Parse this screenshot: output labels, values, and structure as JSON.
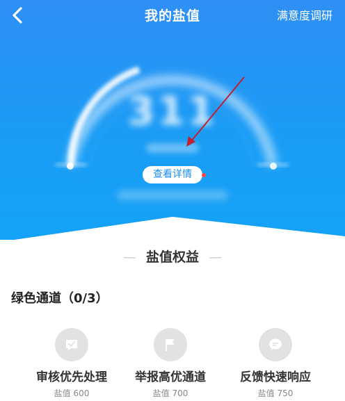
{
  "header": {
    "title": "我的盐值",
    "survey_label": "满意度调研"
  },
  "score": {
    "value": "311",
    "detail_button": "查看详情"
  },
  "rights": {
    "title": "盐值权益",
    "channel_title": "绿色通道（0/3）",
    "items": [
      {
        "label": "审核优先处理",
        "requirement": "盐值 600",
        "icon": "check-message-icon"
      },
      {
        "label": "举报高优通道",
        "requirement": "盐值 700",
        "icon": "flag-icon"
      },
      {
        "label": "反馈快速响应",
        "requirement": "盐值 750",
        "icon": "chat-bubble-icon"
      }
    ]
  },
  "colors": {
    "hero_top": "#2f8ff5",
    "hero_bottom": "#14a2f6",
    "accent": "#1a8ef0",
    "annotation_arrow": "#c0202f"
  }
}
